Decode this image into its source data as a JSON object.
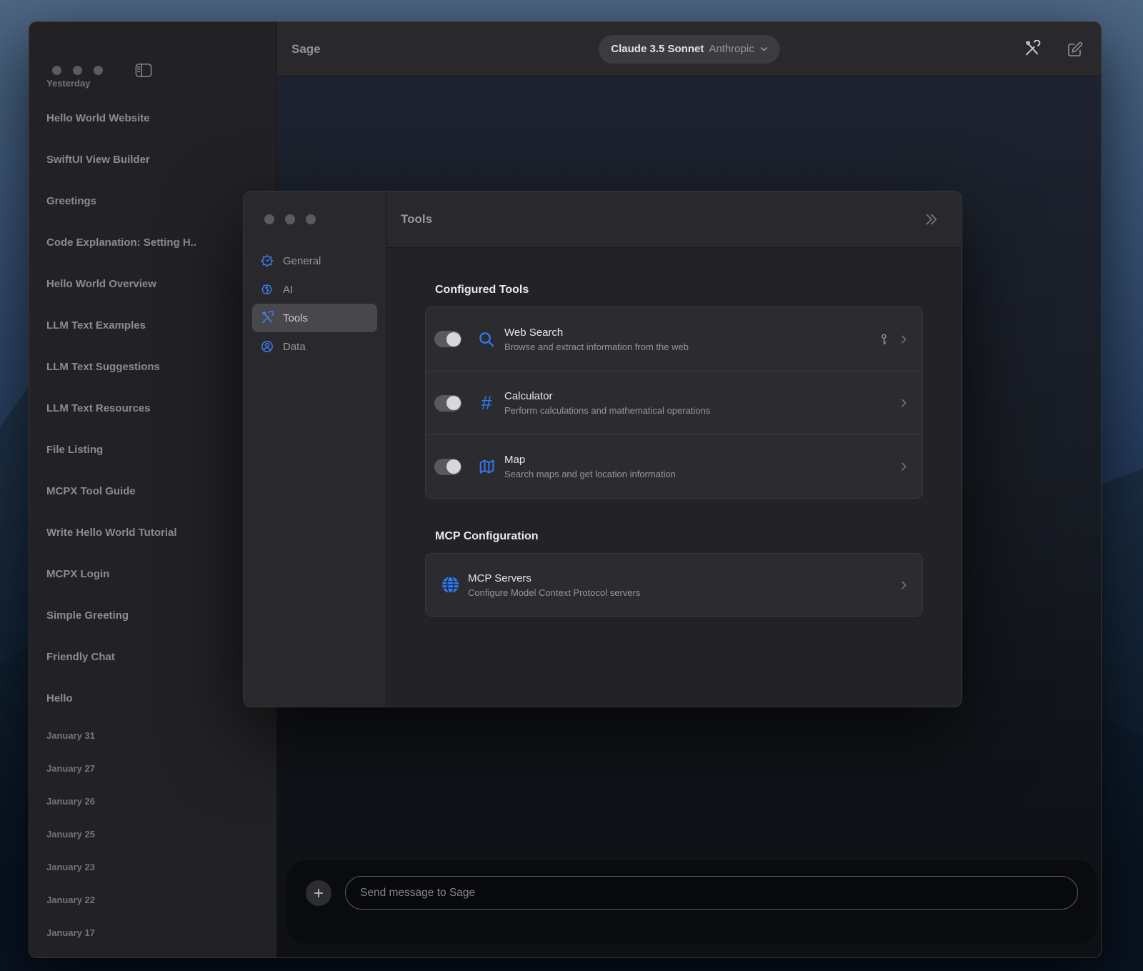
{
  "colors": {
    "accent_blue": "#2e7cf6",
    "tab_icon_blue": "#3f82f7",
    "window_bg": "#212124",
    "modal_bg": "#29292c",
    "toggle_track": "#59595e"
  },
  "window": {
    "titlebar": {
      "app_title": "Sage",
      "model_name": "Claude 3.5 Sonnet",
      "model_provider": "Anthropic",
      "action_icons": [
        "tools-icon",
        "compose-icon"
      ]
    },
    "sidebar": {
      "section_header": "Yesterday",
      "chats": [
        "Hello World Website",
        "SwiftUI View Builder",
        "Greetings",
        "Code Explanation: Setting H..",
        "Hello World Overview",
        "LLM Text Examples",
        "LLM Text Suggestions",
        "LLM Text Resources",
        "File Listing",
        "MCPX Tool Guide",
        "Write Hello World Tutorial",
        "MCPX Login",
        "Simple Greeting",
        "Friendly Chat",
        "Hello"
      ],
      "date_headers": [
        "January 31",
        "January 27",
        "January 26",
        "January 25",
        "January 23",
        "January 22",
        "January 17"
      ]
    },
    "composer": {
      "placeholder": "Send message to Sage"
    }
  },
  "settings": {
    "title": "Tools",
    "tabs": [
      {
        "label": "General",
        "icon": "gauge-icon",
        "selected": false
      },
      {
        "label": "AI",
        "icon": "brain-icon",
        "selected": false
      },
      {
        "label": "Tools",
        "icon": "tools-icon",
        "selected": true
      },
      {
        "label": "Data",
        "icon": "person-icon",
        "selected": false
      }
    ],
    "configured_tools": {
      "heading": "Configured Tools",
      "rows": [
        {
          "title": "Web Search",
          "desc": "Browse and extract information from the web",
          "icon": "search-icon",
          "enabled": true,
          "requires_key": true
        },
        {
          "title": "Calculator",
          "desc": "Perform calculations and mathematical operations",
          "icon": "hash-icon",
          "enabled": true,
          "requires_key": false
        },
        {
          "title": "Map",
          "desc": "Search maps and get location information",
          "icon": "map-icon",
          "enabled": true,
          "requires_key": false
        }
      ]
    },
    "mcp": {
      "heading": "MCP Configuration",
      "rows": [
        {
          "title": "MCP Servers",
          "desc": "Configure Model Context Protocol servers",
          "icon": "globe-icon"
        }
      ]
    }
  }
}
